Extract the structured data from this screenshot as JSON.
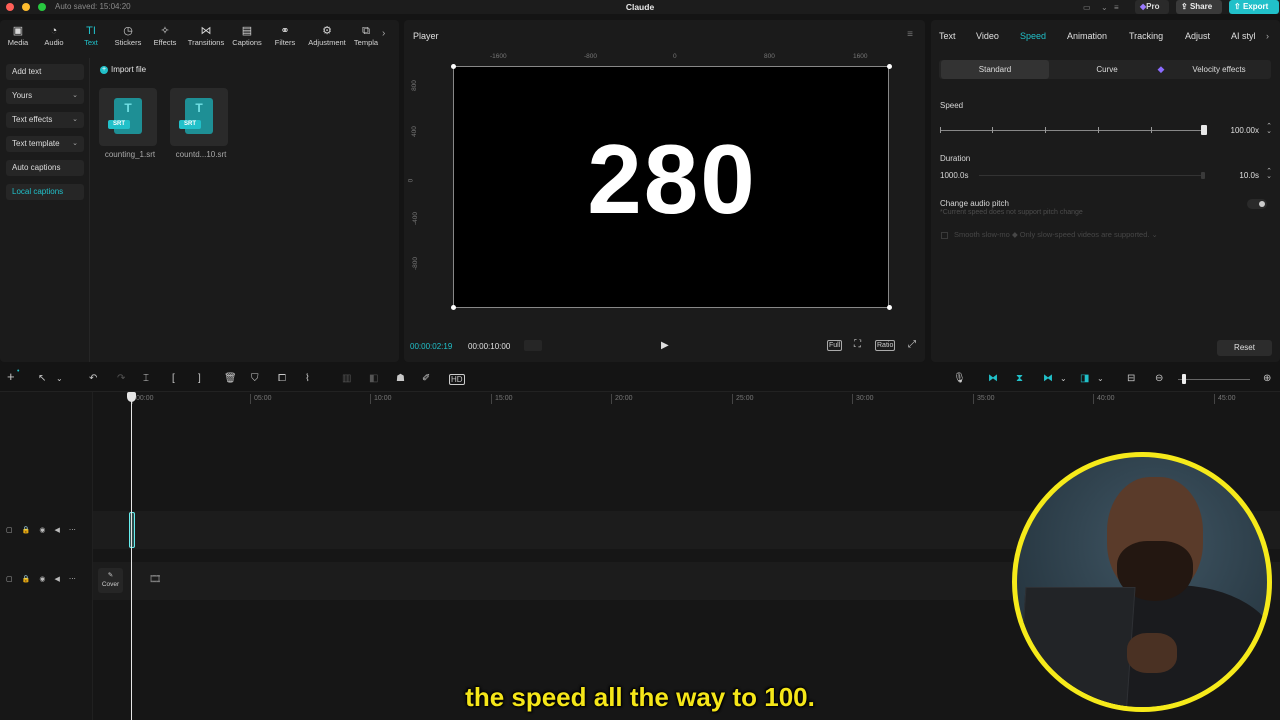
{
  "titlebar": {
    "autosave": "Auto saved: 15:04:20",
    "app_title": "Claude",
    "pro": "Pro",
    "share": "Share",
    "export": "Export"
  },
  "toolstrip": [
    {
      "label": "Media",
      "icon": "media-icon"
    },
    {
      "label": "Audio",
      "icon": "audio-icon"
    },
    {
      "label": "Text",
      "icon": "text-icon",
      "active": true
    },
    {
      "label": "Stickers",
      "icon": "stickers-icon"
    },
    {
      "label": "Effects",
      "icon": "effects-icon"
    },
    {
      "label": "Transitions",
      "icon": "transitions-icon"
    },
    {
      "label": "Captions",
      "icon": "captions-icon"
    },
    {
      "label": "Filters",
      "icon": "filters-icon"
    },
    {
      "label": "Adjustment",
      "icon": "adjustment-icon"
    },
    {
      "label": "Templa",
      "icon": "templates-icon"
    }
  ],
  "sidebar": {
    "items": [
      {
        "label": "Add text"
      },
      {
        "label": "Yours"
      },
      {
        "label": "Text effects"
      },
      {
        "label": "Text template"
      },
      {
        "label": "Auto captions"
      },
      {
        "label": "Local captions",
        "active": true
      }
    ]
  },
  "media": {
    "import_label": "Import file",
    "file_badge": "SRT",
    "file_glyph": "T",
    "files": [
      {
        "name": "counting_1.srt"
      },
      {
        "name": "countd...10.srt"
      }
    ]
  },
  "player": {
    "title": "Player",
    "ruler_h": [
      "-1600",
      "-800",
      "0",
      "800",
      "1600"
    ],
    "ruler_v": [
      "800",
      "400",
      "0",
      "-400",
      "-800"
    ],
    "canvas_text": "280",
    "current_time": "00:00:02:19",
    "total_time": "00:00:10:00",
    "controls": {
      "full": "Full",
      "ratio": "Ratio"
    }
  },
  "inspector": {
    "tabs": [
      "Text",
      "Video",
      "Speed",
      "Animation",
      "Tracking",
      "Adjust",
      "AI styl"
    ],
    "active_tab": "Speed",
    "modes": [
      "Standard",
      "Curve",
      "Velocity effects"
    ],
    "speed_label": "Speed",
    "speed_value": "100.00x",
    "speed_fraction": 1.0,
    "duration_label": "Duration",
    "duration_left": "1000.0s",
    "duration_value": "10.0s",
    "pitch_label": "Change audio pitch",
    "pitch_note": "*Current speed does not support pitch change",
    "smooth_label": "Smooth slow-mo",
    "smooth_note": "Only slow-speed videos are supported.",
    "reset": "Reset"
  },
  "timeline": {
    "ruler": [
      "00:00",
      "05:00",
      "10:00",
      "15:00",
      "20:00",
      "25:00",
      "30:00",
      "35:00",
      "40:00",
      "45:00"
    ],
    "cover_label": "Cover"
  },
  "subtitle": "the speed all the way to 100.",
  "colors": {
    "accent": "#21c0c9",
    "subtitle": "#f5e619",
    "webcam_ring": "#f6ea1a"
  }
}
